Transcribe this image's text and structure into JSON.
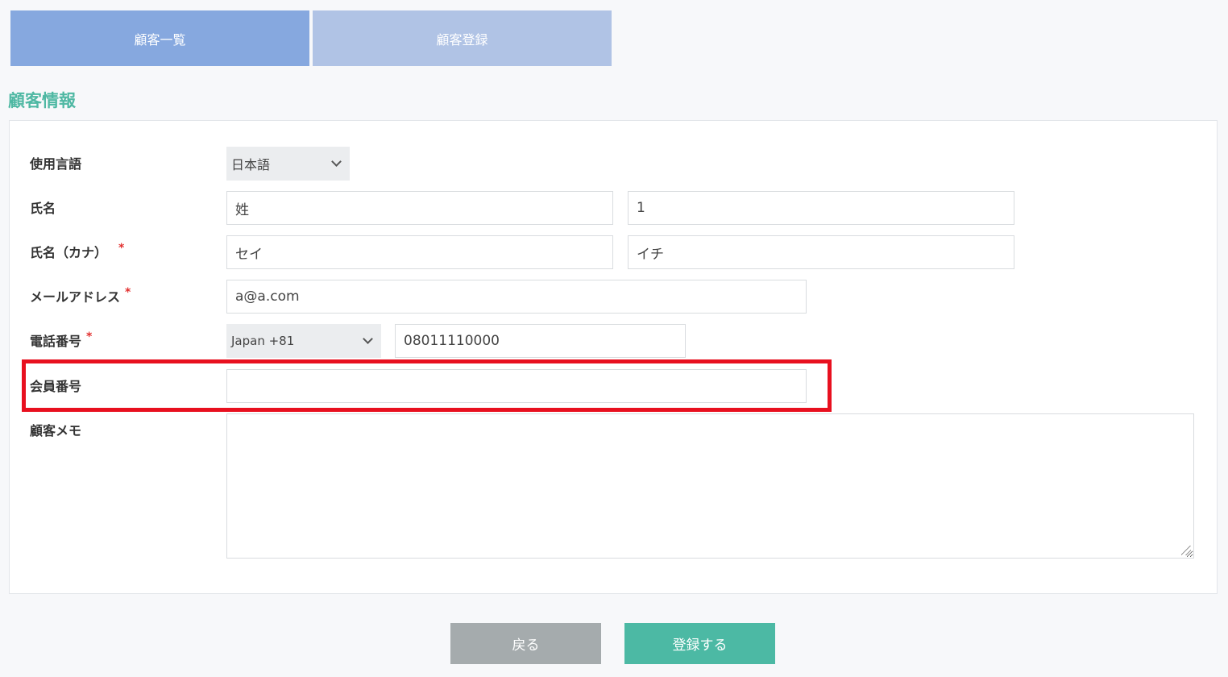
{
  "tabs": {
    "list_label": "顧客一覧",
    "register_label": "顧客登録"
  },
  "section_title": "顧客情報",
  "form": {
    "language": {
      "label": "使用言語",
      "selected": "日本語"
    },
    "name": {
      "label": "氏名",
      "last": "姓",
      "first": "1"
    },
    "kana": {
      "label": "氏名（カナ）",
      "required_mark": "*",
      "last": "セイ",
      "first": "イチ"
    },
    "email": {
      "label": "メールアドレス",
      "required_mark": "*",
      "value": "a@a.com"
    },
    "phone": {
      "label": "電話番号",
      "required_mark": "*",
      "country": "Japan +81",
      "number": "08011110000"
    },
    "member_no": {
      "label": "会員番号",
      "value": ""
    },
    "memo": {
      "label": "顧客メモ",
      "value": ""
    }
  },
  "buttons": {
    "back_label": "戻る",
    "submit_label": "登録する"
  },
  "colors": {
    "accent": "#4fb8a3",
    "highlight": "#e8101f",
    "tab_active": "#86a8df",
    "tab_inactive": "#b0c3e5"
  }
}
